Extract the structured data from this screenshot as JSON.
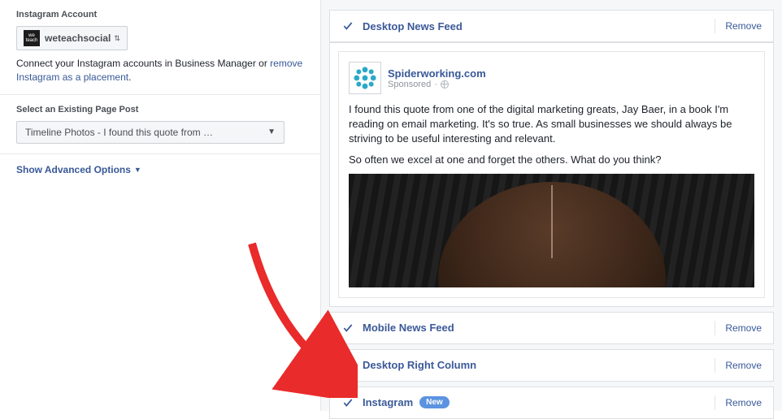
{
  "left": {
    "instagram_label": "Instagram Account",
    "account_name": "weteachsocial",
    "connect_text_prefix": "Connect your Instagram accounts in Business Manager or ",
    "remove_link": "remove Instagram as a placement",
    "period": ".",
    "select_post_label": "Select an Existing Page Post",
    "post_dropdown_value": "Timeline Photos - I found this quote from …",
    "advanced_toggle": "Show Advanced Options"
  },
  "placements": {
    "desktop_feed": "Desktop News Feed",
    "mobile_feed": "Mobile News Feed",
    "right_column": "Desktop Right Column",
    "instagram": "Instagram",
    "new_badge": "New",
    "remove": "Remove"
  },
  "preview": {
    "page_name": "Spiderworking.com",
    "sponsored": "Sponsored",
    "paragraph1": "I found this quote from one of the digital marketing greats, Jay Baer, in a book I'm reading on email marketing. It's so true. As small businesses we should always be striving to be useful interesting and relevant.",
    "paragraph2": "So often we excel at one and forget the others. What do you think?"
  }
}
